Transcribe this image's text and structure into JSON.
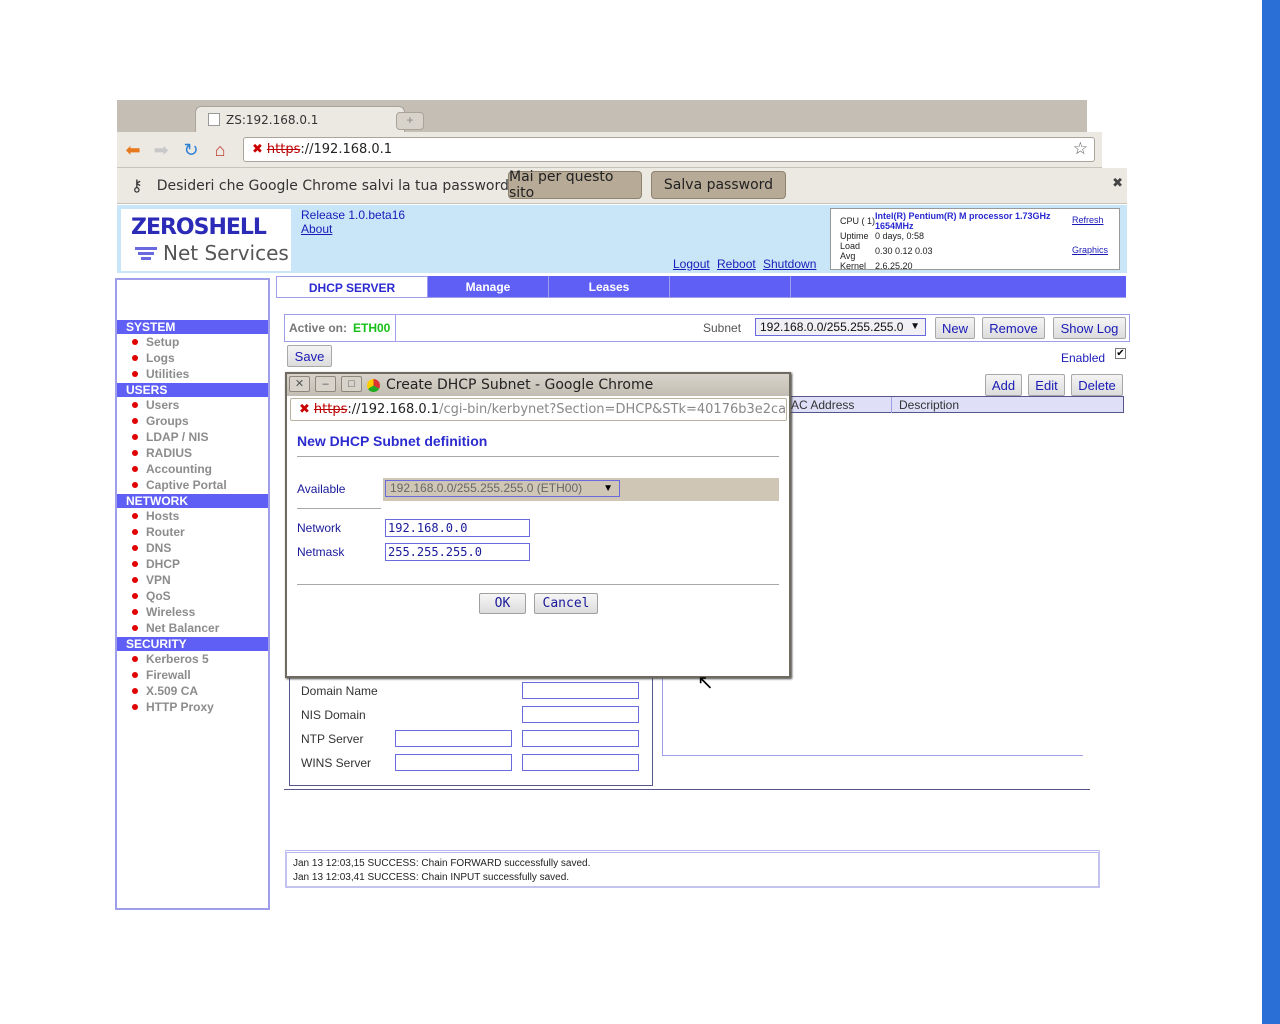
{
  "browser": {
    "tab_title": "ZS:192.168.0.1",
    "new_tab_icon": "plus-icon",
    "url_scheme": "https",
    "url_host": "://192.168.0.1",
    "infobar": {
      "icon": "key-icon",
      "message": "Desideri che Google Chrome salvi la tua password?",
      "never_button": "Mai per questo sito",
      "save_button": "Salva password"
    }
  },
  "header": {
    "logo_title": "ZEROSHELL",
    "logo_subtitle": "Net Services",
    "release": "Release 1.0.beta16",
    "about": "About",
    "links": [
      "Logout",
      "Reboot",
      "Shutdown"
    ],
    "sysinfo": {
      "cpu_label": "CPU ( 1)",
      "cpu_value": "Intel(R) Pentium(R) M processor 1.73GHz",
      "cpu_mhz": "1654MHz",
      "uptime_label": "Uptime",
      "uptime_value": "0 days, 0:58",
      "load_label_1": "Load",
      "load_label_2": "Avg",
      "load_value": "0.30 0.12 0.03",
      "kernel_label": "Kernel",
      "kernel_value": "2.6.25.20",
      "refresh": "Refresh",
      "graphics": "Graphics"
    }
  },
  "sidebar": {
    "sections": [
      {
        "title": "SYSTEM",
        "items": [
          "Setup",
          "Logs",
          "Utilities"
        ]
      },
      {
        "title": "USERS",
        "items": [
          "Users",
          "Groups",
          "LDAP / NIS",
          "RADIUS",
          "Accounting",
          "Captive Portal"
        ]
      },
      {
        "title": "NETWORK",
        "items": [
          "Hosts",
          "Router",
          "DNS",
          "DHCP",
          "VPN",
          "QoS",
          "Wireless",
          "Net Balancer"
        ]
      },
      {
        "title": "SECURITY",
        "items": [
          "Kerberos 5",
          "Firewall",
          "X.509 CA",
          "HTTP Proxy"
        ]
      }
    ]
  },
  "tabs": [
    "DHCP SERVER",
    "Manage",
    "Leases"
  ],
  "main": {
    "active_on_label": "Active on:",
    "active_on_value": "ETH00",
    "subnet_label": "Subnet",
    "subnet_value": "192.168.0.0/255.255.255.0",
    "new_button": "New",
    "remove_button": "Remove",
    "showlog_button": "Show Log",
    "save_button": "Save",
    "enabled_label": "Enabled",
    "enabled_checked": true,
    "add_button": "Add",
    "edit_button": "Edit",
    "delete_button": "Delete",
    "table_columns": [
      "AC Address",
      "Description"
    ],
    "fields": [
      {
        "label": "Domain Name"
      },
      {
        "label": "NIS Domain"
      },
      {
        "label": "NTP Server"
      },
      {
        "label": "WINS Server"
      }
    ]
  },
  "log": [
    "Jan 13 12:03,15 SUCCESS: Chain FORWARD successfully saved.",
    "Jan 13 12:03,41 SUCCESS: Chain INPUT successfully saved."
  ],
  "popup": {
    "window_title": "Create DHCP Subnet - Google Chrome",
    "url_scheme": "https",
    "url_host": "://192.168.0.1",
    "url_path": "/cgi-bin/kerbynet?Section=DHCP&STk=40176b3e2ca",
    "heading": "New DHCP Subnet definition",
    "available_label": "Available",
    "available_value": "192.168.0.0/255.255.255.0 (ETH00)",
    "network_label": "Network",
    "network_value": "192.168.0.0",
    "netmask_label": "Netmask",
    "netmask_value": "255.255.255.0",
    "ok_button": "OK",
    "cancel_button": "Cancel"
  }
}
